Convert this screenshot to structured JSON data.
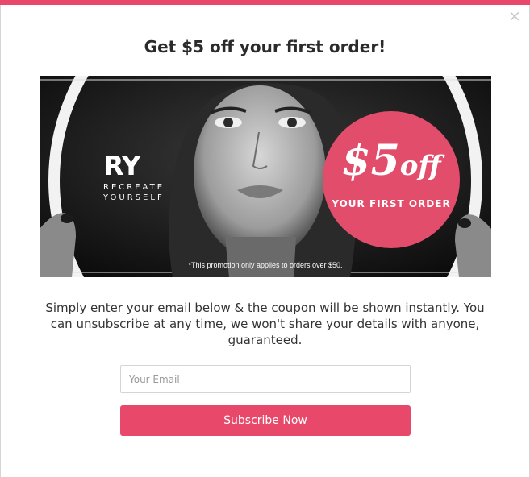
{
  "popup": {
    "headline": "Get $5 off your first order!",
    "close_symbol": "×",
    "accent_color": "#e8486a"
  },
  "banner": {
    "logo_mark": "RY",
    "logo_line1": "RECREATE",
    "logo_line2": "YOURSELF",
    "promo_amount": "$5",
    "promo_off": "off",
    "promo_subtitle": "YOUR FIRST ORDER",
    "fine_print": "*This promotion only applies to orders over $50.",
    "badge_color": "#e34d6c"
  },
  "body": {
    "description": "Simply enter your email below & the coupon will be shown instantly. You can unsubscribe at any time, we won't share your details with anyone, guaranteed."
  },
  "form": {
    "email_placeholder": "Your Email",
    "email_value": "",
    "subscribe_label": "Subscribe Now"
  }
}
